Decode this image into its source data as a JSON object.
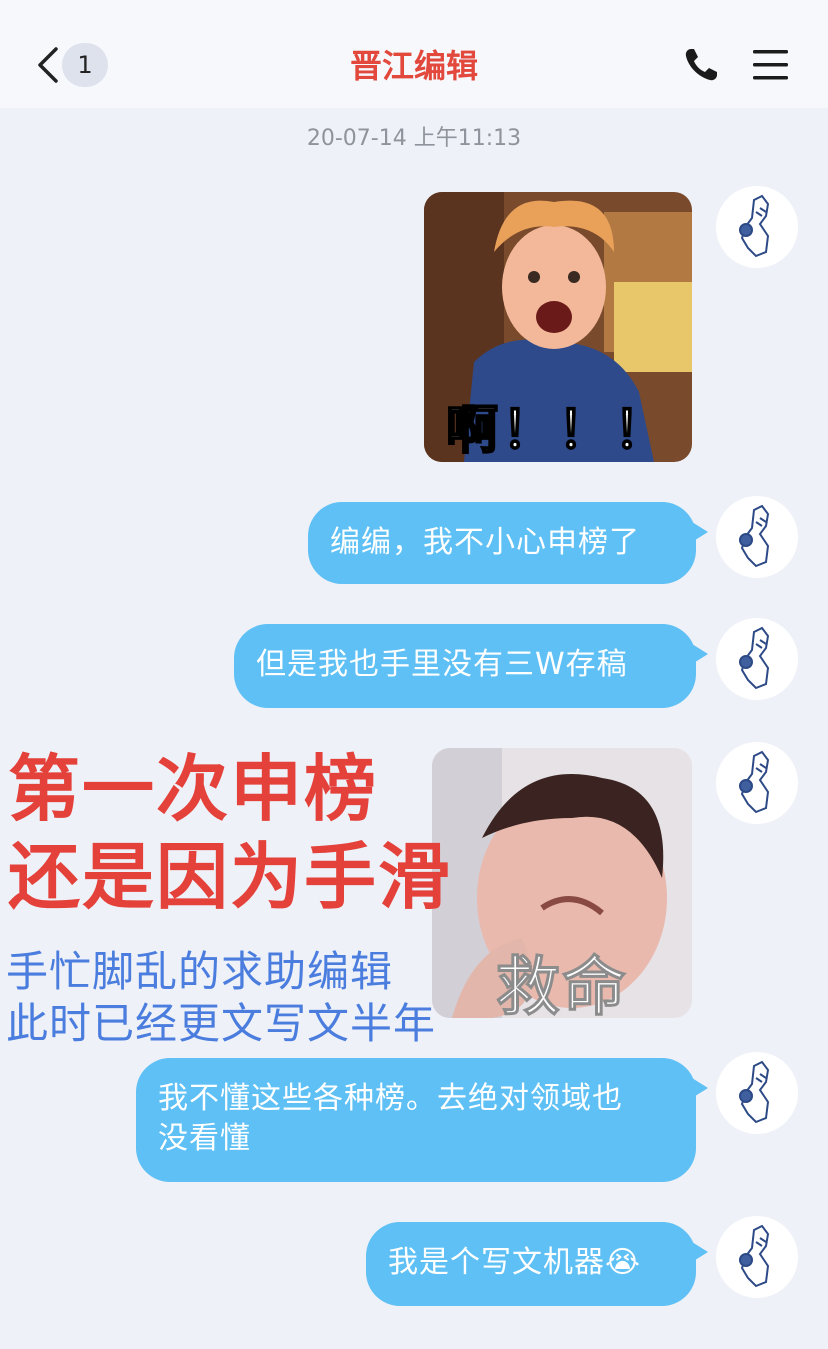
{
  "header": {
    "unread_count": "1",
    "title": "晋江编辑",
    "back_icon": "chevron-left-icon",
    "call_icon": "phone-icon",
    "menu_icon": "hamburger-menu-icon",
    "title_color": "#e2483c"
  },
  "chat": {
    "timestamp": "20-07-14 上午11:13",
    "bubble_color": "#5ec0f5",
    "messages": [
      {
        "type": "sticker",
        "caption": "啊！！！"
      },
      {
        "type": "text",
        "text": "编编，我不小心申榜了"
      },
      {
        "type": "text",
        "text": "但是我也手里没有三W存稿"
      },
      {
        "type": "sticker",
        "caption": "救命"
      },
      {
        "type": "text",
        "line1": "我不懂这些各种榜。去绝对领域也",
        "line2": "没看懂"
      },
      {
        "type": "text",
        "text": "我是个写文机器😭"
      }
    ]
  },
  "overlay": {
    "red_line1": "第一次申榜",
    "red_line2": "还是因为手滑",
    "blue_line1": "手忙脚乱的求助编辑",
    "blue_line2": "此时已经更文写文半年"
  }
}
